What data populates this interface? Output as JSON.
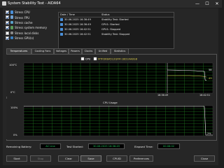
{
  "window": {
    "title": "System Stability Test - AIDA64",
    "minimize": "—",
    "maximize": "☐",
    "close": "✕"
  },
  "stress_options": [
    {
      "label": "Stress CPU",
      "checked": true,
      "icon_color": "#4a8fd8"
    },
    {
      "label": "Stress FPU",
      "checked": true,
      "icon_color": "#6fa0d0"
    },
    {
      "label": "Stress cache",
      "checked": true,
      "icon_color": "#5aa0c8"
    },
    {
      "label": "Stress system memory",
      "checked": true,
      "icon_color": "#5a9a5a"
    },
    {
      "label": "Stress local disks",
      "checked": false,
      "icon_color": "#8a8a8a"
    },
    {
      "label": "Stress GPU(s)",
      "checked": true,
      "icon_color": "#3a7fbf"
    }
  ],
  "log": {
    "headers": {
      "datetime": "Date / Time",
      "status": "Status"
    },
    "rows": [
      {
        "datetime": "30.06.2025 16:36:49",
        "status": "Stability Test: Started"
      },
      {
        "datetime": "30.06.2025 16:36:49",
        "status": "GPU1: Started"
      },
      {
        "datetime": "30.06.2025 16:42:51",
        "status": "GPU1: Stopped"
      },
      {
        "datetime": "30.06.2025 16:42:51",
        "status": "Stability Test: Stopped"
      }
    ]
  },
  "tabs": [
    "Temperatures",
    "Cooling Fans",
    "Voltages",
    "Powers",
    "Clocks",
    "Unified",
    "Statistics"
  ],
  "temperature_chart": {
    "legend": {
      "cpu": "CPU",
      "disk": "MTFDKBA512QFM-1BD1AABGB"
    },
    "y_top": "100°C",
    "y_bottom": "0°C",
    "x_start": "16:36:49",
    "x_end": "16:42:51",
    "value_upper": "58",
    "value_lower": "43"
  },
  "usage_chart": {
    "title": "CPU Usage",
    "y_top": "100%",
    "y_bottom": "0%",
    "value_right": "2%"
  },
  "status": {
    "battery_label": "Remaining Battery:",
    "battery_value": "AC Line",
    "started_label": "Test Started:",
    "started_value": "30.06.2025 16:36:49",
    "elapsed_label": "Elapsed Time:",
    "elapsed_value": "00:06:02"
  },
  "buttons": {
    "start": "Start",
    "stop": "Stop",
    "clear": "Clear",
    "save": "Save",
    "cpuid": "CPUID",
    "preferences": "Preferences",
    "close": "Close"
  },
  "colors": {
    "grid": "#1f7a1f",
    "plot": "#000000",
    "cpu_line": "#ffffff",
    "disk_line": "#d6c84a",
    "usage_line": "#ffffff",
    "accent": "#22c55e"
  }
}
